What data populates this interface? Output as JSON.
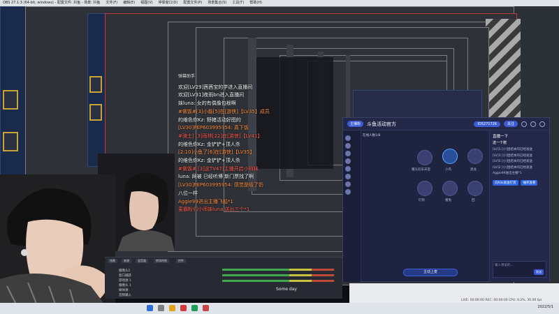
{
  "menubar": {
    "items": [
      "OBS 27.1.3 (64-bit, windows) - 配置文件: 抖鱼 - 场景: 抖鱼",
      "文件(F)",
      "编辑(E)",
      "视图(V)",
      "停靠窗口(D)",
      "配置文件(P)",
      "场景集合(S)",
      "工具(T)",
      "帮助(H)"
    ]
  },
  "chat": {
    "title": "弹幕助手",
    "lines": [
      {
        "text": "欢迎[LV29]茜茜宝的学进入直播间",
        "color": "w"
      },
      {
        "text": "欢迎[LV31]夜雨bn进入直播间",
        "color": "w"
      },
      {
        "text": "妹luna:   女的有偶像包袱啊",
        "color": "w"
      },
      {
        "text": "#做饭#[3]小磊[5]在[游侠]【LV35】成员",
        "color": "o"
      },
      {
        "text": "的维色你Kz:   野猪活动好图的",
        "color": "w"
      },
      {
        "text": "[LV30]PEP603995954:   真下饭",
        "color": "o"
      },
      {
        "text": "#骑士] [3]雨林[22]在[游侠]【LV41】",
        "color": "r"
      },
      {
        "text": "的维色你Kz:   金铲铲+顶人杀",
        "color": "w"
      },
      {
        "text": "[2:10]小鱼了[6]在[游侠]【LV35】",
        "color": "o"
      },
      {
        "text": "的维色你Kz:   金铲铲+顶人杀",
        "color": "w"
      },
      {
        "text": "#做饭# [3]这TV47]主播开启小师妹",
        "color": "r"
      },
      {
        "text": "luna:   网被 已经听博 新门票找了啊",
        "color": "w"
      },
      {
        "text": "[LV30]PEP603995954:   感觉是吸了奶",
        "color": "o"
      },
      {
        "text": "八位一样",
        "color": "w"
      },
      {
        "text": "Aggie99进出主播飞船*1",
        "color": "o"
      },
      {
        "text": "麦霸粉们小师妹luna 送出三个*1",
        "color": "r"
      }
    ]
  },
  "live": {
    "room_badge": "主播粉",
    "room_name": "斗鱼活动官方",
    "id_chip": "ID5271726",
    "follow_btn": "关注",
    "online_label": "在线人数1/8",
    "side_title": "直播一下",
    "side_sub": "送一个赠",
    "side_lines": [
      "[LV]1 [小]团结本的已经发送",
      "[LV]3 [小]团结本的已经发送",
      "[LV]5 [小]团结本的已经发送",
      "[LV]2 [小]团结本的已经发送",
      "Aggie99进出主播*1"
    ],
    "chip1": "向Kiki发送打赏",
    "chip2": "抽奖查看",
    "input_placeholder": "输入想说的...",
    "send": "发送",
    "mic_label": "主动上麦",
    "seats": [
      "猪头尼乐天官",
      "小鸟",
      "黑龙",
      "叮铃",
      "猪兔",
      "回"
    ]
  },
  "obs": {
    "tabs": [
      "场景",
      "来源",
      "混音器",
      "转场特效",
      "控件"
    ],
    "sources": [
      "摄像头1",
      "窗口捕获",
      "游戏源 1",
      "摄像头 1",
      "媒体源",
      "音频输入"
    ],
    "song": "Some day"
  },
  "status": {
    "text": "LIVE: 00:00:00   REC: 00:00:00   CPU: 9.2%, 30.00 fps"
  },
  "taskbar": {
    "clock": "2022/5/1"
  }
}
